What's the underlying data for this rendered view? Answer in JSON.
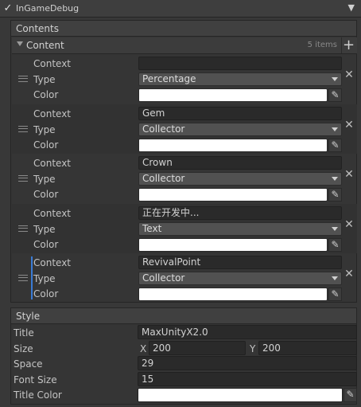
{
  "header": {
    "title": "InGameDebug",
    "checkbox": "checkmark-icon",
    "menu": "triangle-down-icon"
  },
  "contents": {
    "title": "Contents",
    "list_title": "Content",
    "count": "5 items",
    "add": "+",
    "labels": {
      "context": "Context",
      "type": "Type",
      "color": "Color"
    },
    "items": [
      {
        "context": "",
        "type": "Percentage",
        "color": "#ffffff"
      },
      {
        "context": "Gem",
        "type": "Collector",
        "color": "#ffffff"
      },
      {
        "context": "Crown",
        "type": "Collector",
        "color": "#ffffff"
      },
      {
        "context": "正在开发中...",
        "type": "Text",
        "color": "#ffffff"
      },
      {
        "context": "RevivalPoint",
        "type": "Collector",
        "color": "#ffffff"
      }
    ]
  },
  "style": {
    "title": "Style",
    "rows": {
      "title_label": "Title",
      "title_value": "MaxUnityX2.0",
      "size_label": "Size",
      "size_x_label": "X",
      "size_x": "200",
      "size_y_label": "Y",
      "size_y": "200",
      "space_label": "Space",
      "space_value": "29",
      "font_size_label": "Font Size",
      "font_size_value": "15",
      "title_color_label": "Title Color",
      "title_color": "#ffffff"
    }
  }
}
